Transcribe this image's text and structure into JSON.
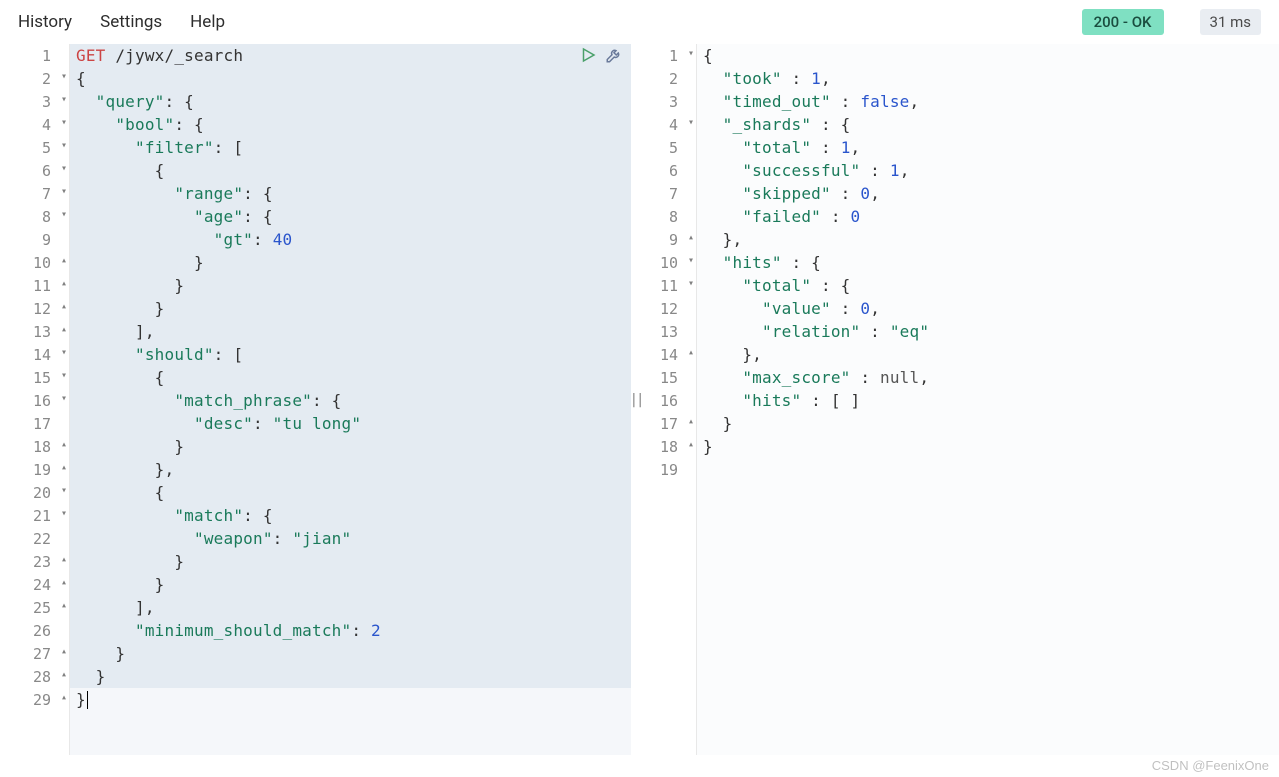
{
  "menu": {
    "history": "History",
    "settings": "Settings",
    "help": "Help"
  },
  "status": {
    "code": "200 - OK",
    "timing": "31 ms"
  },
  "request": {
    "method": "GET",
    "path": "/jywx/_search",
    "lines": [
      {
        "n": 1,
        "fold": "",
        "sel": true,
        "t": [
          [
            "method",
            "GET"
          ],
          [
            "path",
            " /jywx"
          ],
          [
            "path",
            "/_search"
          ]
        ]
      },
      {
        "n": 2,
        "fold": "▾",
        "sel": true,
        "t": [
          [
            "punc",
            "{"
          ]
        ]
      },
      {
        "n": 3,
        "fold": "▾",
        "sel": true,
        "t": [
          [
            "punc",
            "  "
          ],
          [
            "key",
            "\"query\""
          ],
          [
            "punc",
            ": {"
          ]
        ]
      },
      {
        "n": 4,
        "fold": "▾",
        "sel": true,
        "t": [
          [
            "punc",
            "    "
          ],
          [
            "key",
            "\"bool\""
          ],
          [
            "punc",
            ": {"
          ]
        ]
      },
      {
        "n": 5,
        "fold": "▾",
        "sel": true,
        "t": [
          [
            "punc",
            "      "
          ],
          [
            "key",
            "\"filter\""
          ],
          [
            "punc",
            ": ["
          ]
        ]
      },
      {
        "n": 6,
        "fold": "▾",
        "sel": true,
        "t": [
          [
            "punc",
            "        {"
          ]
        ]
      },
      {
        "n": 7,
        "fold": "▾",
        "sel": true,
        "t": [
          [
            "punc",
            "          "
          ],
          [
            "key",
            "\"range\""
          ],
          [
            "punc",
            ": {"
          ]
        ]
      },
      {
        "n": 8,
        "fold": "▾",
        "sel": true,
        "t": [
          [
            "punc",
            "            "
          ],
          [
            "key",
            "\"age\""
          ],
          [
            "punc",
            ": {"
          ]
        ]
      },
      {
        "n": 9,
        "fold": "",
        "sel": true,
        "t": [
          [
            "punc",
            "              "
          ],
          [
            "key",
            "\"gt\""
          ],
          [
            "punc",
            ": "
          ],
          [
            "num",
            "40"
          ]
        ]
      },
      {
        "n": 10,
        "fold": "▴",
        "sel": true,
        "t": [
          [
            "punc",
            "            }"
          ]
        ]
      },
      {
        "n": 11,
        "fold": "▴",
        "sel": true,
        "t": [
          [
            "punc",
            "          }"
          ]
        ]
      },
      {
        "n": 12,
        "fold": "▴",
        "sel": true,
        "t": [
          [
            "punc",
            "        }"
          ]
        ]
      },
      {
        "n": 13,
        "fold": "▴",
        "sel": true,
        "t": [
          [
            "punc",
            "      ],"
          ]
        ]
      },
      {
        "n": 14,
        "fold": "▾",
        "sel": true,
        "t": [
          [
            "punc",
            "      "
          ],
          [
            "key",
            "\"should\""
          ],
          [
            "punc",
            ": ["
          ]
        ]
      },
      {
        "n": 15,
        "fold": "▾",
        "sel": true,
        "t": [
          [
            "punc",
            "        {"
          ]
        ]
      },
      {
        "n": 16,
        "fold": "▾",
        "sel": true,
        "t": [
          [
            "punc",
            "          "
          ],
          [
            "key",
            "\"match_phrase\""
          ],
          [
            "punc",
            ": {"
          ]
        ]
      },
      {
        "n": 17,
        "fold": "",
        "sel": true,
        "t": [
          [
            "punc",
            "            "
          ],
          [
            "key",
            "\"desc\""
          ],
          [
            "punc",
            ": "
          ],
          [
            "str",
            "\"tu long\""
          ]
        ]
      },
      {
        "n": 18,
        "fold": "▴",
        "sel": true,
        "t": [
          [
            "punc",
            "          }"
          ]
        ]
      },
      {
        "n": 19,
        "fold": "▴",
        "sel": true,
        "t": [
          [
            "punc",
            "        },"
          ]
        ]
      },
      {
        "n": 20,
        "fold": "▾",
        "sel": true,
        "t": [
          [
            "punc",
            "        {"
          ]
        ]
      },
      {
        "n": 21,
        "fold": "▾",
        "sel": true,
        "t": [
          [
            "punc",
            "          "
          ],
          [
            "key",
            "\"match\""
          ],
          [
            "punc",
            ": {"
          ]
        ]
      },
      {
        "n": 22,
        "fold": "",
        "sel": true,
        "t": [
          [
            "punc",
            "            "
          ],
          [
            "key",
            "\"weapon\""
          ],
          [
            "punc",
            ": "
          ],
          [
            "str",
            "\"jian\""
          ]
        ]
      },
      {
        "n": 23,
        "fold": "▴",
        "sel": true,
        "t": [
          [
            "punc",
            "          }"
          ]
        ]
      },
      {
        "n": 24,
        "fold": "▴",
        "sel": true,
        "t": [
          [
            "punc",
            "        }"
          ]
        ]
      },
      {
        "n": 25,
        "fold": "▴",
        "sel": true,
        "t": [
          [
            "punc",
            "      ],"
          ]
        ]
      },
      {
        "n": 26,
        "fold": "",
        "sel": true,
        "t": [
          [
            "punc",
            "      "
          ],
          [
            "key",
            "\"minimum_should_match\""
          ],
          [
            "punc",
            ": "
          ],
          [
            "num",
            "2"
          ]
        ]
      },
      {
        "n": 27,
        "fold": "▴",
        "sel": true,
        "t": [
          [
            "punc",
            "    }"
          ]
        ]
      },
      {
        "n": 28,
        "fold": "▴",
        "sel": true,
        "t": [
          [
            "punc",
            "  }"
          ]
        ]
      },
      {
        "n": 29,
        "fold": "▴",
        "sel": false,
        "t": [
          [
            "punc",
            "}"
          ]
        ],
        "cursor": true
      }
    ]
  },
  "response": {
    "lines": [
      {
        "n": 1,
        "fold": "▾",
        "t": [
          [
            "punc",
            "{"
          ]
        ]
      },
      {
        "n": 2,
        "fold": "",
        "t": [
          [
            "punc",
            "  "
          ],
          [
            "key",
            "\"took\""
          ],
          [
            "punc",
            " : "
          ],
          [
            "num",
            "1"
          ],
          [
            "punc",
            ","
          ]
        ]
      },
      {
        "n": 3,
        "fold": "",
        "t": [
          [
            "punc",
            "  "
          ],
          [
            "key",
            "\"timed_out\""
          ],
          [
            "punc",
            " : "
          ],
          [
            "bool",
            "false"
          ],
          [
            "punc",
            ","
          ]
        ]
      },
      {
        "n": 4,
        "fold": "▾",
        "t": [
          [
            "punc",
            "  "
          ],
          [
            "key",
            "\"_shards\""
          ],
          [
            "punc",
            " : {"
          ]
        ]
      },
      {
        "n": 5,
        "fold": "",
        "t": [
          [
            "punc",
            "    "
          ],
          [
            "key",
            "\"total\""
          ],
          [
            "punc",
            " : "
          ],
          [
            "num",
            "1"
          ],
          [
            "punc",
            ","
          ]
        ]
      },
      {
        "n": 6,
        "fold": "",
        "t": [
          [
            "punc",
            "    "
          ],
          [
            "key",
            "\"successful\""
          ],
          [
            "punc",
            " : "
          ],
          [
            "num",
            "1"
          ],
          [
            "punc",
            ","
          ]
        ]
      },
      {
        "n": 7,
        "fold": "",
        "t": [
          [
            "punc",
            "    "
          ],
          [
            "key",
            "\"skipped\""
          ],
          [
            "punc",
            " : "
          ],
          [
            "num",
            "0"
          ],
          [
            "punc",
            ","
          ]
        ]
      },
      {
        "n": 8,
        "fold": "",
        "t": [
          [
            "punc",
            "    "
          ],
          [
            "key",
            "\"failed\""
          ],
          [
            "punc",
            " : "
          ],
          [
            "num",
            "0"
          ]
        ]
      },
      {
        "n": 9,
        "fold": "▴",
        "t": [
          [
            "punc",
            "  },"
          ]
        ]
      },
      {
        "n": 10,
        "fold": "▾",
        "t": [
          [
            "punc",
            "  "
          ],
          [
            "key",
            "\"hits\""
          ],
          [
            "punc",
            " : {"
          ]
        ]
      },
      {
        "n": 11,
        "fold": "▾",
        "t": [
          [
            "punc",
            "    "
          ],
          [
            "key",
            "\"total\""
          ],
          [
            "punc",
            " : {"
          ]
        ]
      },
      {
        "n": 12,
        "fold": "",
        "t": [
          [
            "punc",
            "      "
          ],
          [
            "key",
            "\"value\""
          ],
          [
            "punc",
            " : "
          ],
          [
            "num",
            "0"
          ],
          [
            "punc",
            ","
          ]
        ]
      },
      {
        "n": 13,
        "fold": "",
        "t": [
          [
            "punc",
            "      "
          ],
          [
            "key",
            "\"relation\""
          ],
          [
            "punc",
            " : "
          ],
          [
            "str",
            "\"eq\""
          ]
        ]
      },
      {
        "n": 14,
        "fold": "▴",
        "t": [
          [
            "punc",
            "    },"
          ]
        ]
      },
      {
        "n": 15,
        "fold": "",
        "t": [
          [
            "punc",
            "    "
          ],
          [
            "key",
            "\"max_score\""
          ],
          [
            "punc",
            " : "
          ],
          [
            "null",
            "null"
          ],
          [
            "punc",
            ","
          ]
        ]
      },
      {
        "n": 16,
        "fold": "",
        "t": [
          [
            "punc",
            "    "
          ],
          [
            "key",
            "\"hits\""
          ],
          [
            "punc",
            " : [ ]"
          ]
        ]
      },
      {
        "n": 17,
        "fold": "▴",
        "t": [
          [
            "punc",
            "  }"
          ]
        ]
      },
      {
        "n": 18,
        "fold": "▴",
        "t": [
          [
            "punc",
            "}"
          ]
        ]
      },
      {
        "n": 19,
        "fold": "",
        "t": []
      }
    ]
  },
  "watermark": "CSDN @FeenixOne"
}
